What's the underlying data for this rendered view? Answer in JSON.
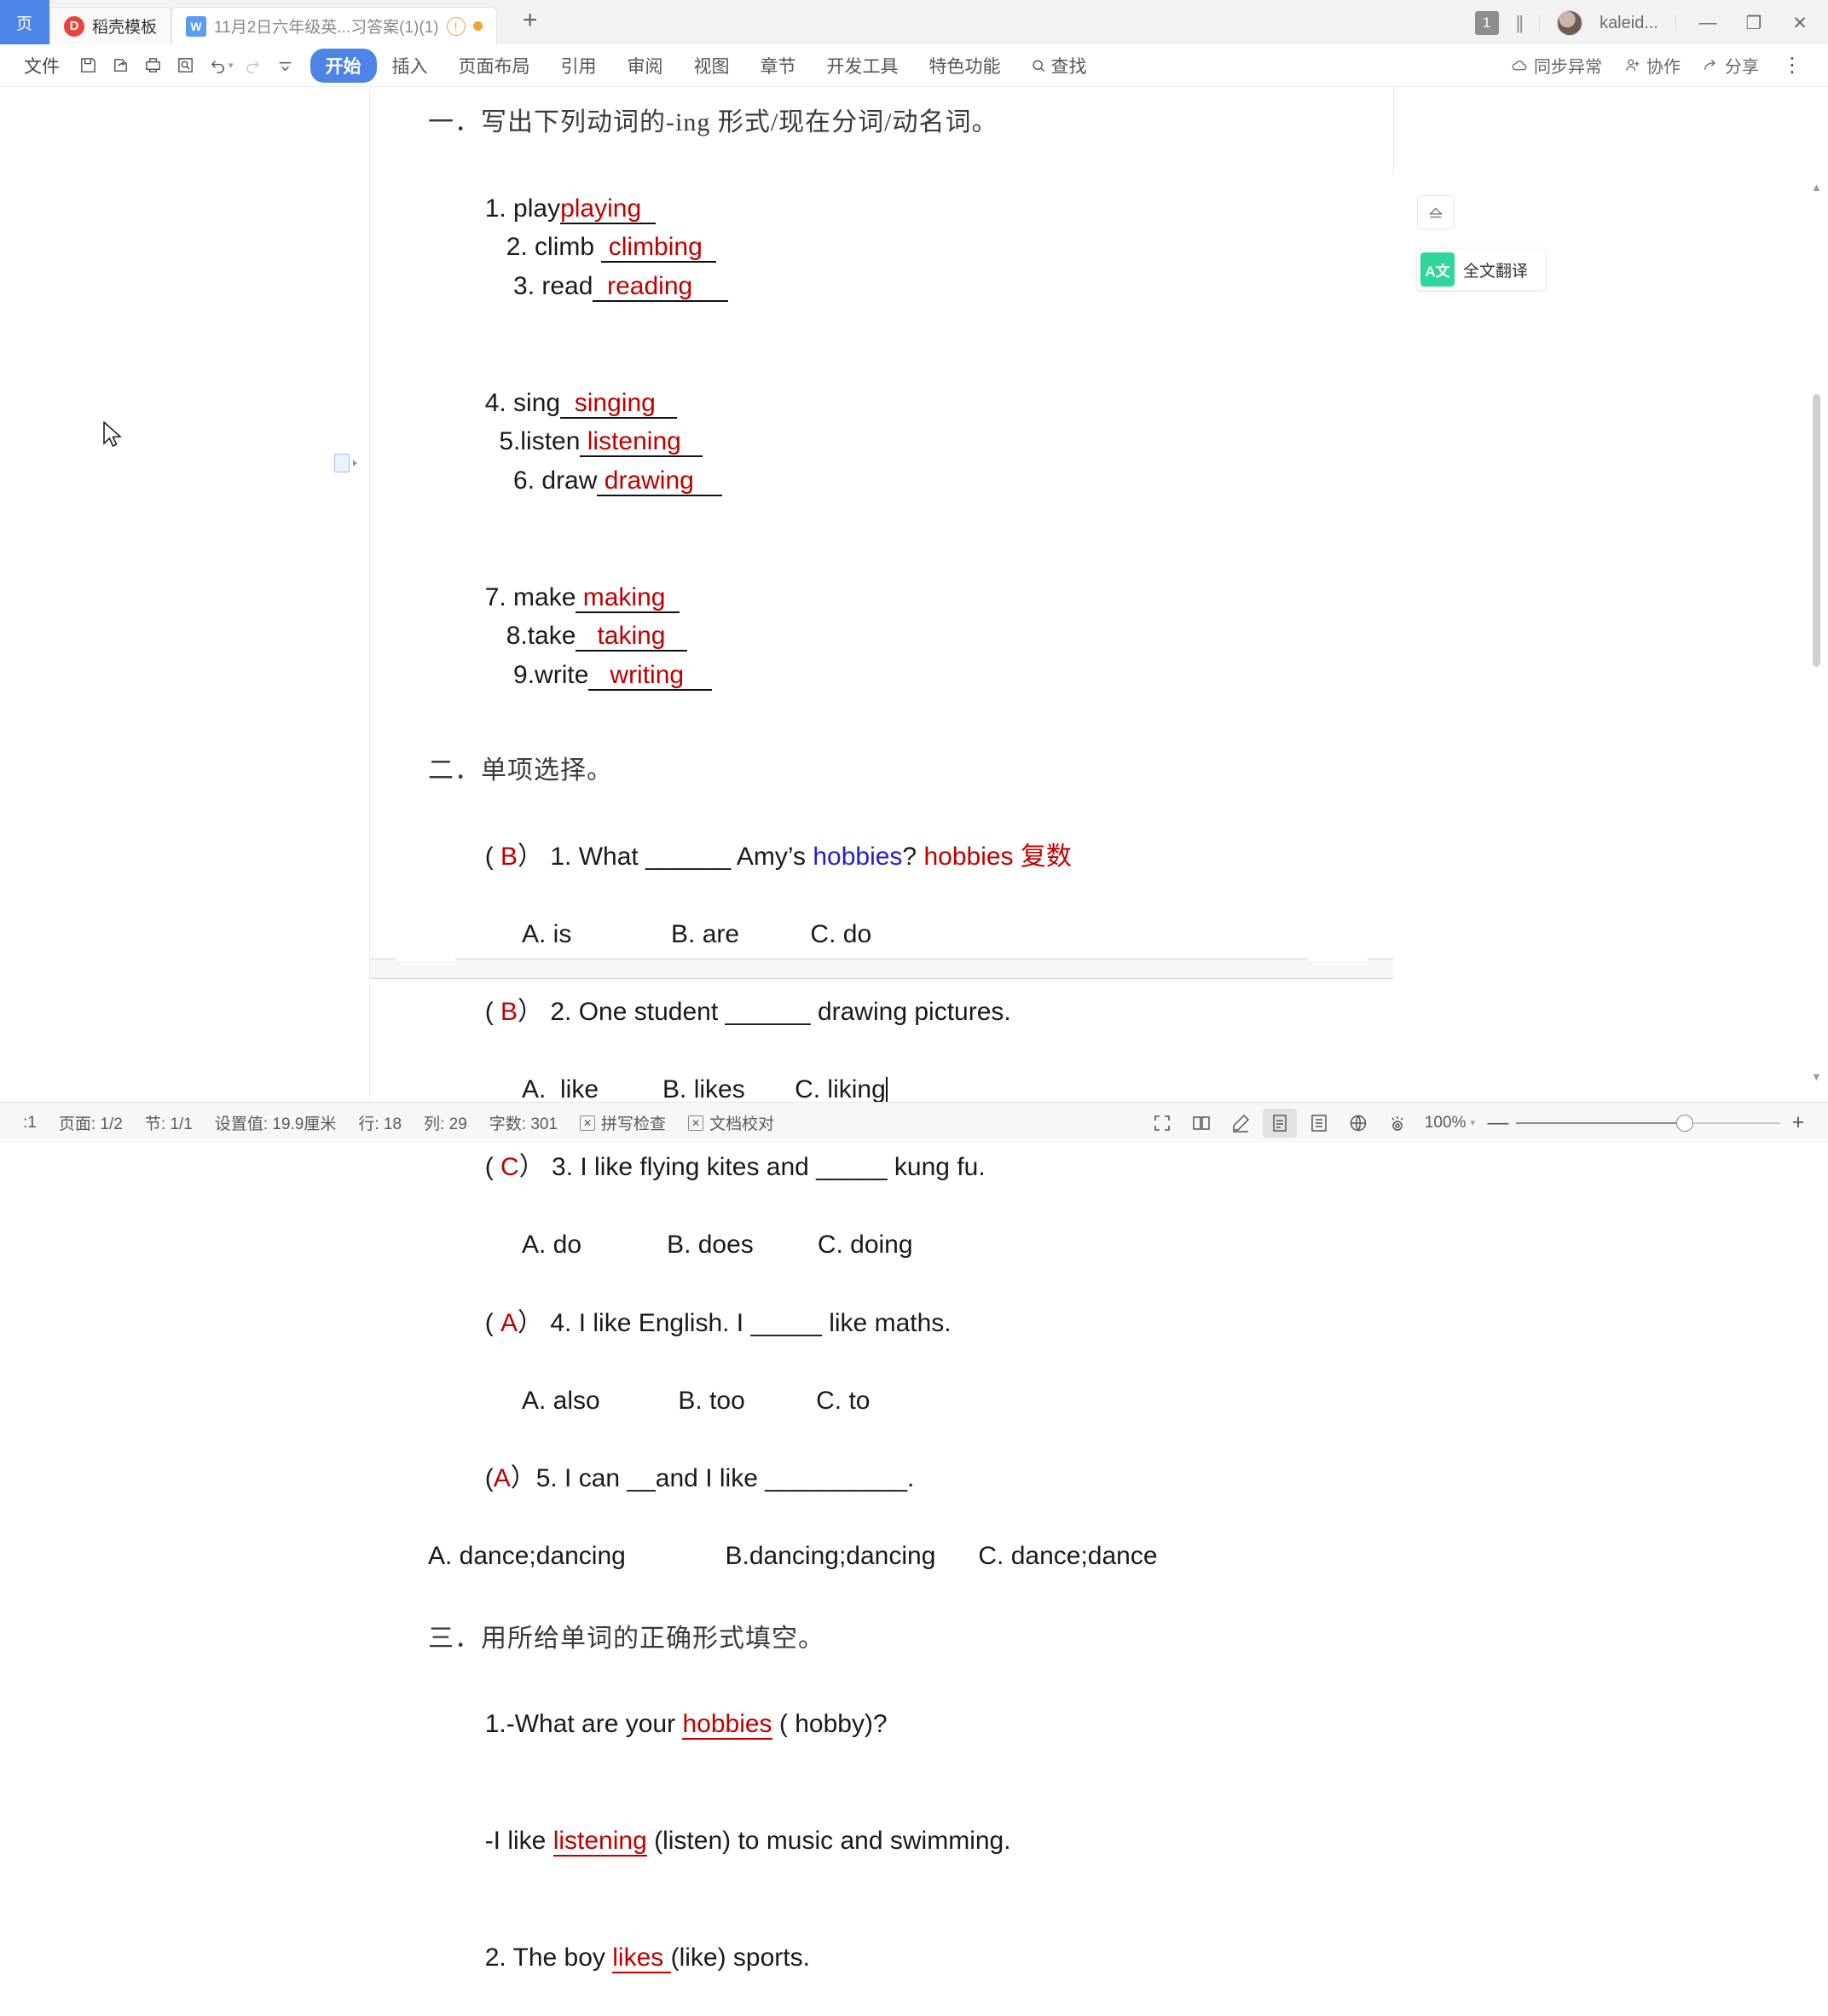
{
  "titlebar": {
    "home_label": "页",
    "tabs": [
      {
        "label": "稻壳模板",
        "icon": "dh-logo-icon"
      },
      {
        "label": "11月2日六年级英...习答案(1)(1)",
        "icon": "wps-writer-icon",
        "warn": "!",
        "modified_dot": true
      }
    ],
    "new_tab": "+",
    "notif_count": "1",
    "username": "kaleid...",
    "win_minimize": "—",
    "win_restore": "❐",
    "win_close": "✕"
  },
  "ribbon": {
    "file_label": "文件",
    "quick_icons": [
      "save-icon",
      "save-as-icon",
      "print-icon",
      "print-preview-icon",
      "undo-icon",
      "redo-icon",
      "customize-icon"
    ],
    "tabs": [
      {
        "label": "开始",
        "active": true
      },
      {
        "label": "插入",
        "active": false
      },
      {
        "label": "页面布局",
        "active": false
      },
      {
        "label": "引用",
        "active": false
      },
      {
        "label": "审阅",
        "active": false
      },
      {
        "label": "视图",
        "active": false
      },
      {
        "label": "章节",
        "active": false
      },
      {
        "label": "开发工具",
        "active": false
      },
      {
        "label": "特色功能",
        "active": false
      }
    ],
    "find_label": "查找",
    "right_items": [
      {
        "label": "同步异常",
        "icon": "cloud-warning-icon"
      },
      {
        "label": "协作",
        "icon": "user-plus-icon"
      },
      {
        "label": "分享",
        "icon": "share-icon"
      }
    ],
    "more_label": "⋮"
  },
  "document": {
    "section1": {
      "heading": "一．写出下列动词的-ing 形式/现在分词/动名词。",
      "rows": [
        [
          {
            "n": "1. play",
            "ans": "playing"
          },
          {
            "n": "2. climb ",
            "ans": "climbing"
          },
          {
            "n": "3. read",
            "ans": "reading"
          }
        ],
        [
          {
            "n": "4. sing",
            "ans": "singing"
          },
          {
            "n": "5.listen",
            "ans": "listening"
          },
          {
            "n": "6. draw",
            "ans": "drawing"
          }
        ],
        [
          {
            "n": "7. make",
            "ans": "making"
          },
          {
            "n": "8.take",
            "ans": "taking"
          },
          {
            "n": "9.write",
            "ans": "writing"
          }
        ]
      ]
    },
    "section2": {
      "heading": "二．单项选择。",
      "questions": [
        {
          "answer": "B",
          "stem_pre": "） 1. What ______ Amy’s ",
          "stem_link": "hobbies",
          "stem_post": "? ",
          "note": "hobbies 复数",
          "options": "A. is              B. are          C. do"
        },
        {
          "answer": "B",
          "stem_pre": "） 2. One student ______ drawing pictures.",
          "stem_link": "",
          "stem_post": "",
          "note": "",
          "options": "A.  like         B. likes       C. liking",
          "has_cursor": true
        },
        {
          "answer": "C",
          "stem_pre": "） 3. I like flying kites and _____ kung fu.",
          "stem_link": "",
          "stem_post": "",
          "note": "",
          "options": "A. do            B. does         C. doing"
        },
        {
          "answer": "A",
          "stem_pre": "） 4. I like English. I _____ like maths.",
          "stem_link": "",
          "stem_post": "",
          "note": "",
          "options": "A. also           B. too          C. to"
        },
        {
          "answer": "A",
          "stem_pre": "）5. I can __and I like __________.",
          "stem_link": "",
          "stem_post": "",
          "note": "",
          "options": ""
        }
      ],
      "q5_choices": "A. dance;dancing              B.dancing;dancing      C. dance;dance"
    },
    "section3": {
      "heading": "三．用所给单词的正确形式填空。",
      "lines": [
        {
          "pre": "1.-What are your ",
          "ans": "hobbies",
          "post": " ( hobby)?"
        },
        {
          "pre": "-I like ",
          "ans": "listening",
          "post": " (listen) to music and swimming."
        },
        {
          "pre": "2. The boy ",
          "ans": "likes ",
          "post": "(like) sports."
        }
      ]
    }
  },
  "right_panel": {
    "eject_icon": "eject-icon",
    "translate_label": "全文翻译",
    "translate_icon": "translate-icon"
  },
  "statusbar": {
    "left_items": [
      ":1",
      "页面: 1/2",
      "节: 1/1",
      "设置值: 19.9厘米",
      "行: 18",
      "列: 29",
      "字数: 301"
    ],
    "spellcheck_label": "拼写检查",
    "proofread_label": "文档校对",
    "view_buttons": [
      "fullscreen-icon",
      "book-view-icon",
      "edit-mode-icon",
      "page-view-icon",
      "outline-view-icon",
      "web-view-icon",
      "eye-protect-icon"
    ],
    "selected_view": "page-view-icon",
    "zoom_label": "100%",
    "zoom_minus": "—",
    "zoom_plus": "+"
  },
  "colors": {
    "accent": "#4e83e8",
    "answer_red": "#c00000",
    "link_blue": "#2222cc",
    "translate_green": "#2fd79b"
  }
}
